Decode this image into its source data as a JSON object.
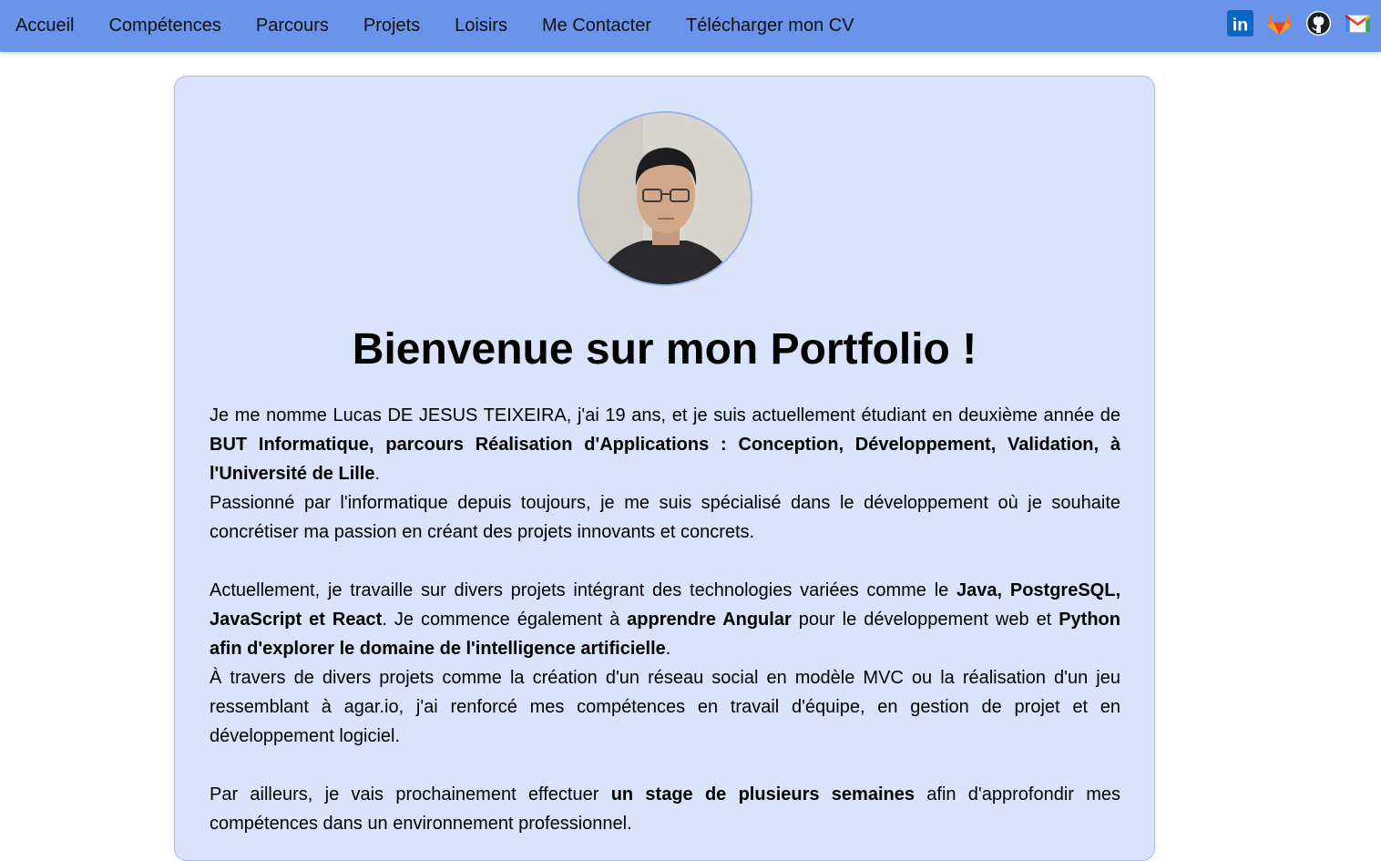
{
  "nav": {
    "items": [
      {
        "label": "Accueil"
      },
      {
        "label": "Compétences"
      },
      {
        "label": "Parcours"
      },
      {
        "label": "Projets"
      },
      {
        "label": "Loisirs"
      },
      {
        "label": "Me Contacter"
      },
      {
        "label": "Télécharger mon CV"
      }
    ],
    "social": [
      "linkedin-icon",
      "gitlab-icon",
      "github-icon",
      "gmail-icon"
    ],
    "linkedin_text": "in",
    "color": "#6a93ea"
  },
  "colors": {
    "card_bg": "#d9e3fa",
    "card_border": "#a9bde9"
  },
  "hero": {
    "title": "Bienvenue sur mon Portfolio !",
    "p1": {
      "t1": "Je me nomme Lucas DE JESUS TEIXEIRA, j'ai 19 ans, et je suis actuellement étudiant en deuxième année de ",
      "b1": "BUT Informatique, parcours Réalisation d'Applications : Conception, Développement, Validation, à l'Université de Lille",
      "t2": "."
    },
    "p2": "Passionné par l'informatique depuis toujours, je me suis spécialisé dans le développement où je souhaite concrétiser ma passion en créant des projets innovants et concrets.",
    "p3": {
      "t1": "Actuellement, je travaille sur divers projets intégrant des technologies variées comme le ",
      "b1": "Java, PostgreSQL, JavaScript et React",
      "t2": ". Je commence également à ",
      "b2": "apprendre Angular",
      "t3": " pour le développement web et ",
      "b3": "Python afin d'explorer le domaine de l'intelligence artificielle",
      "t4": "."
    },
    "p4": "À travers de divers projets comme la création d'un réseau social en modèle MVC ou la réalisation d'un jeu ressemblant à agar.io, j'ai renforcé mes compétences en travail d'équipe, en gestion de projet et en développement logiciel.",
    "p5": {
      "t1": "Par ailleurs, je vais prochainement effectuer ",
      "b1": "un stage de plusieurs semaines",
      "t2": " afin d'approfondir mes compétences dans un environnement professionnel."
    }
  }
}
